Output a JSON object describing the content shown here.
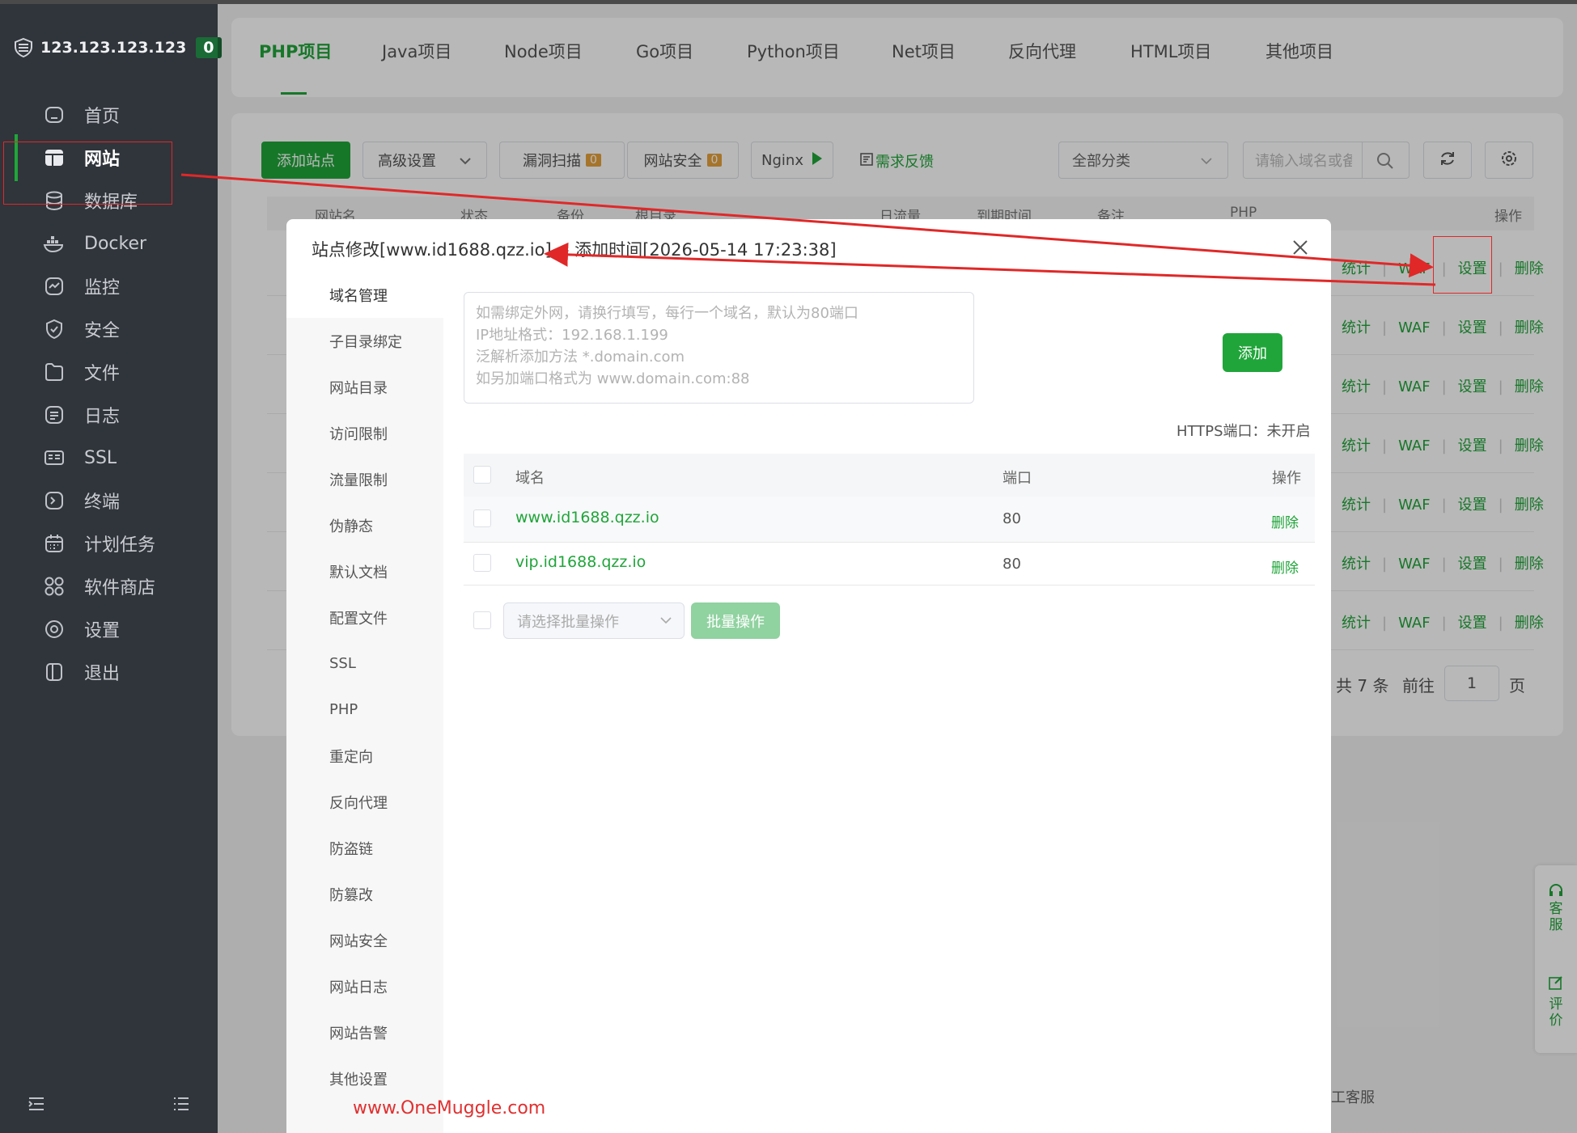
{
  "sidebar": {
    "server_ip": "123.123.123.123",
    "badge": "0",
    "items": [
      {
        "label": "首页",
        "icon": "home-icon"
      },
      {
        "label": "网站",
        "icon": "website-icon"
      },
      {
        "label": "数据库",
        "icon": "database-icon"
      },
      {
        "label": "Docker",
        "icon": "docker-icon"
      },
      {
        "label": "监控",
        "icon": "monitor-icon"
      },
      {
        "label": "安全",
        "icon": "shield-icon"
      },
      {
        "label": "文件",
        "icon": "folder-icon"
      },
      {
        "label": "日志",
        "icon": "log-icon"
      },
      {
        "label": "SSL",
        "icon": "ssl-icon"
      },
      {
        "label": "终端",
        "icon": "terminal-icon"
      },
      {
        "label": "计划任务",
        "icon": "calendar-icon"
      },
      {
        "label": "软件商店",
        "icon": "apps-icon"
      },
      {
        "label": "设置",
        "icon": "gear-icon"
      },
      {
        "label": "退出",
        "icon": "logout-icon"
      }
    ]
  },
  "tabs": [
    "PHP项目",
    "Java项目",
    "Node项目",
    "Go项目",
    "Python项目",
    "Net项目",
    "反向代理",
    "HTML项目",
    "其他项目"
  ],
  "toolbar": {
    "add_site": "添加站点",
    "advanced": "高级设置",
    "vuln_scan": "漏洞扫描",
    "vuln_count": "0",
    "site_security": "网站安全",
    "security_count": "0",
    "nginx": "Nginx",
    "feedback": "需求反馈",
    "category": "全部分类",
    "search_placeholder": "请输入域名或备注"
  },
  "site_table": {
    "columns": [
      "网站名",
      "状态",
      "备份",
      "根目录",
      "日流量",
      "到期时间",
      "备注",
      "PHP",
      "操作"
    ],
    "row_actions": [
      "统计",
      "WAF",
      "设置",
      "删除"
    ],
    "pager_total": "共 7 条",
    "pager_goto": "前往",
    "pager_page": "1",
    "pager_suffix": "页"
  },
  "float_widget": {
    "service": "客服",
    "review": "评价"
  },
  "bottom_text": "工客服",
  "modal": {
    "title": "站点修改[www.id1688.qzz.io] -- 添加时间[2026-05-14 17:23:38]",
    "nav": [
      "域名管理",
      "子目录绑定",
      "网站目录",
      "访问限制",
      "流量限制",
      "伪静态",
      "默认文档",
      "配置文件",
      "SSL",
      "PHP",
      "重定向",
      "反向代理",
      "防盗链",
      "防篡改",
      "网站安全",
      "网站日志",
      "网站告警",
      "其他设置"
    ],
    "textarea_lines": [
      "如需绑定外网，请换行填写，每行一个域名，默认为80端口",
      "IP地址格式：192.168.1.199",
      "泛解析添加方法 *.domain.com",
      "如另加端口格式为 www.domain.com:88"
    ],
    "add_button": "添加",
    "https_note": "HTTPS端口：未开启",
    "domain_table": {
      "headers": [
        "域名",
        "端口",
        "操作"
      ],
      "rows": [
        {
          "domain": "www.id1688.qzz.io",
          "port": "80",
          "action": "删除"
        },
        {
          "domain": "vip.id1688.qzz.io",
          "port": "80",
          "action": "删除"
        }
      ]
    },
    "batch_placeholder": "请选择批量操作",
    "batch_button": "批量操作"
  },
  "watermark": "www.OneMuggle.com",
  "colors": {
    "accent": "#20a53a",
    "sidebar": "#30343b",
    "annotation": "#e02828"
  }
}
